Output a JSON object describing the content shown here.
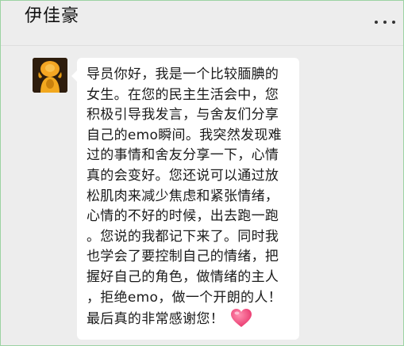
{
  "header": {
    "title": "伊佳豪",
    "more_icon": "more-dots-icon"
  },
  "message": {
    "sender_avatar": "avatar-icon",
    "lines": [
      "导员你好，我是一个比较腼腆的",
      "女生。在您的民主生活会中，您",
      "积极引导我发言，与舍友们分享",
      "自己的emo瞬间。我突然发现难",
      "过的事情和舍友分享一下，心情",
      "真的会变好。您还说可以通过放",
      "松肌肉来减少焦虑和紧张情绪，",
      "心情的不好的时候，出去跑一跑",
      "。您说的我都记下来了。同时我",
      "也学会了要控制自己的情绪，把",
      "握好自己的角色，做情绪的主人",
      "，拒绝emo，做一个开朗的人！",
      "最后真的非常感谢您！"
    ],
    "emoji": "heart-icon",
    "emoji_color": "#f0517a"
  }
}
